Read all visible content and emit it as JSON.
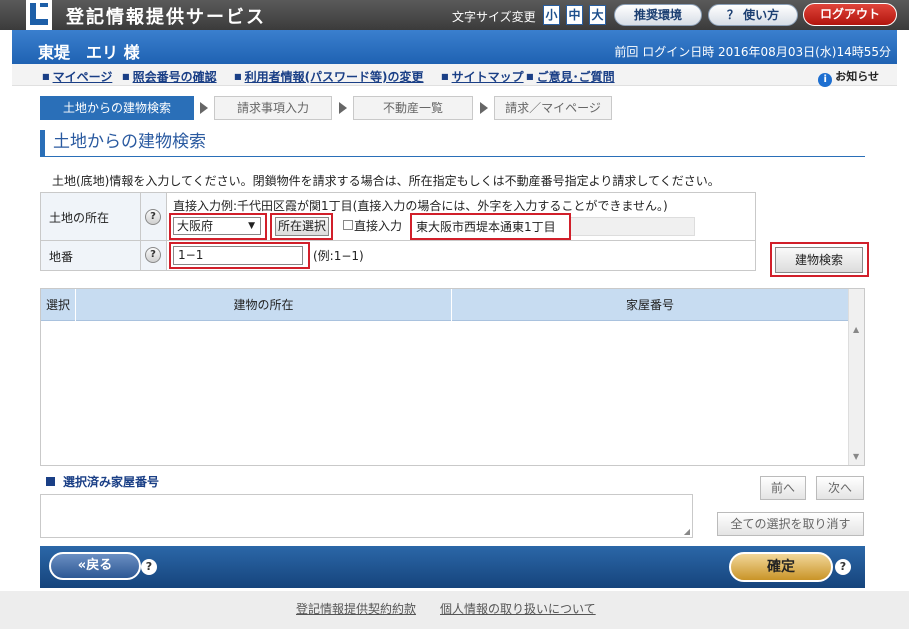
{
  "header": {
    "app_title": "登記情報提供サービス",
    "font_size_label": "文字サイズ変更",
    "font_sizes": [
      "小",
      "中",
      "大"
    ],
    "recommended_env": "推奨環境",
    "how_to_use": "？ 使い方",
    "logout": "ログアウト"
  },
  "user": {
    "name": "東堤　エリ 様",
    "last_login": "前回 ログイン日時 2016年08月03日(水)14時55分"
  },
  "nav": {
    "items": [
      "マイページ",
      "照会番号の確認",
      "利用者情報(パスワード等)の変更",
      "サイトマップ",
      "ご意見･ご質問"
    ],
    "notice": "お知らせ"
  },
  "steps": [
    "土地からの建物検索",
    "請求事項入力",
    "不動産一覧",
    "請求／マイページ"
  ],
  "page": {
    "title": "土地からの建物検索",
    "instruction": "土地(底地)情報を入力してください。閉鎖物件を請求する場合は、所在指定もしくは不動産番号指定より請求してください。"
  },
  "form": {
    "location_label": "土地の所在",
    "example_text": "直接入力例:千代田区霞が関1丁目(直接入力の場合には、外字を入力することができません。)",
    "prefecture": "大阪府",
    "location_select_button": "所在選択",
    "direct_input_label": "直接入力",
    "address_value": "東大阪市西堤本通東1丁目",
    "chiban_label": "地番",
    "chiban_value": "1−1",
    "chiban_example": "(例:1−1)",
    "help": "?"
  },
  "search_button": "建物検索",
  "results": {
    "columns": [
      "選択",
      "建物の所在",
      "家屋番号"
    ],
    "rows": []
  },
  "selected": {
    "label": "選択済み家屋番号",
    "prev": "前へ",
    "next": "次へ",
    "clear_all": "全ての選択を取り消す"
  },
  "footer": {
    "back": "«戻る",
    "confirm": "確定",
    "help": "?",
    "links": [
      "登記情報提供契約約款",
      "個人情報の取り扱いについて"
    ]
  }
}
